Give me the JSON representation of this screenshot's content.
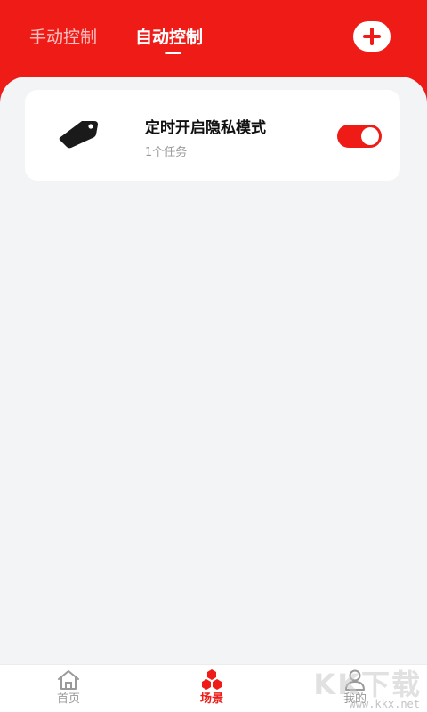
{
  "header": {
    "tabs": [
      {
        "label": "手动控制",
        "active": false
      },
      {
        "label": "自动控制",
        "active": true
      }
    ],
    "add_icon": "plus-icon"
  },
  "scenes": [
    {
      "icon": "tag-icon",
      "title": "定时开启隐私模式",
      "subtitle": "1个任务",
      "enabled": true
    }
  ],
  "bottom_nav": {
    "items": [
      {
        "label": "首页",
        "icon": "home-icon",
        "active": false
      },
      {
        "label": "场景",
        "icon": "scene-icon",
        "active": true
      },
      {
        "label": "我的",
        "icon": "user-icon",
        "active": false
      }
    ]
  },
  "watermark": {
    "logo": "KK下载",
    "url": "www.kkx.net"
  },
  "colors": {
    "accent": "#ee1b17",
    "background": "#f3f4f6",
    "card": "#ffffff",
    "inactive": "#9a9a9a"
  }
}
